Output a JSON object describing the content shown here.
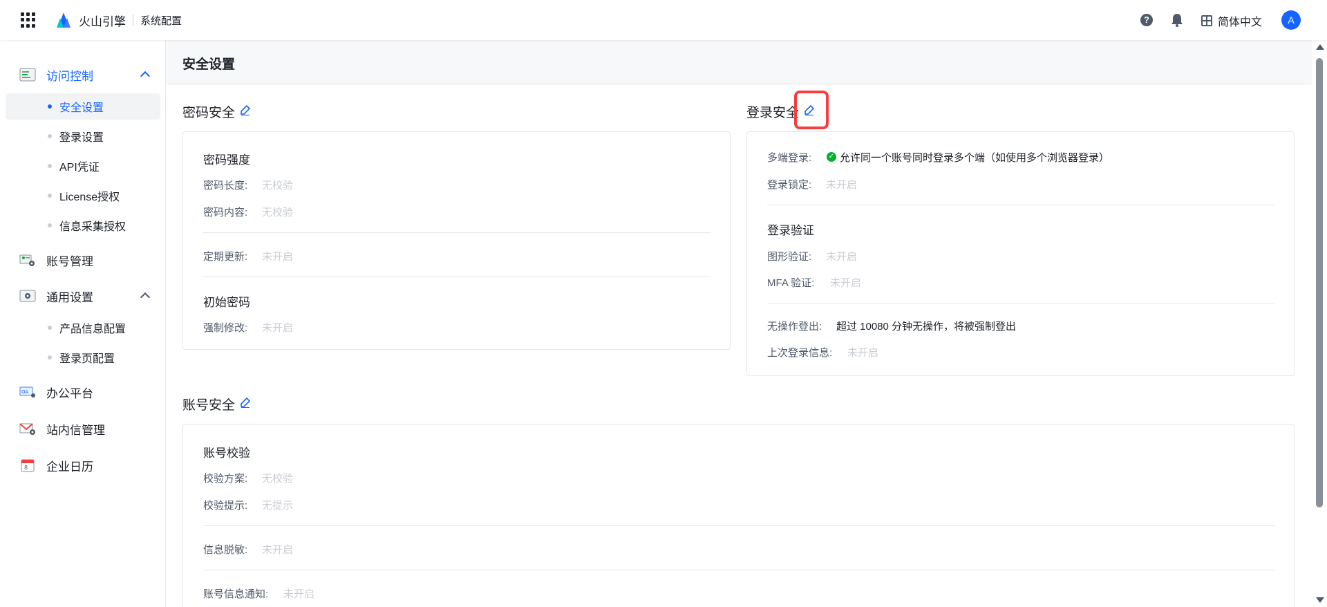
{
  "topbar": {
    "brand": "火山引擎",
    "system_title": "系统配置",
    "help_glyph": "?",
    "language": "简体中文",
    "avatar_letter": "A"
  },
  "sidebar": {
    "groups": [
      {
        "label": "访问控制",
        "icon": "access-control-icon",
        "expanded": true,
        "items": [
          "安全设置",
          "登录设置",
          "API凭证",
          "License授权",
          "信息采集授权"
        ]
      },
      {
        "label": "账号管理",
        "icon": "account-manage-icon"
      },
      {
        "label": "通用设置",
        "icon": "general-settings-icon",
        "expanded": true,
        "items": [
          "产品信息配置",
          "登录页配置"
        ]
      },
      {
        "label": "办公平台",
        "icon": "oa-platform-icon"
      },
      {
        "label": "站内信管理",
        "icon": "mail-manage-icon"
      },
      {
        "label": "企业日历",
        "icon": "calendar-icon"
      }
    ],
    "selected_item": "安全设置"
  },
  "page": {
    "title": "安全设置"
  },
  "password_security": {
    "title": "密码安全",
    "strength_title": "密码强度",
    "length_label": "密码长度:",
    "length_value": "无校验",
    "content_label": "密码内容:",
    "content_value": "无校验",
    "periodic_label": "定期更新:",
    "periodic_value": "未开启",
    "initial_title": "初始密码",
    "force_label": "强制修改:",
    "force_value": "未开启"
  },
  "login_security": {
    "title": "登录安全",
    "multi_label": "多端登录:",
    "multi_value": "允许同一个账号同时登录多个端（如使用多个浏览器登录）",
    "lock_label": "登录锁定:",
    "lock_value": "未开启",
    "verify_title": "登录验证",
    "captcha_label": "图形验证:",
    "captcha_value": "未开启",
    "mfa_label": "MFA 验证:",
    "mfa_value": "未开启",
    "idle_label": "无操作登出:",
    "idle_value": "超过 10080 分钟无操作，将被强制登出",
    "last_login_label": "上次登录信息:",
    "last_login_value": "未开启"
  },
  "account_security": {
    "title": "账号安全",
    "check_title": "账号校验",
    "scheme_label": "校验方案:",
    "scheme_value": "无校验",
    "hint_label": "校验提示:",
    "hint_value": "无提示",
    "mask_label": "信息脱敏:",
    "mask_value": "未开启",
    "notify_label": "账号信息通知:",
    "notify_value": "未开启"
  },
  "colors": {
    "accent": "#1664ff",
    "highlight": "#f53f3f",
    "success": "#00b42a",
    "muted": "#c9cdd4"
  }
}
